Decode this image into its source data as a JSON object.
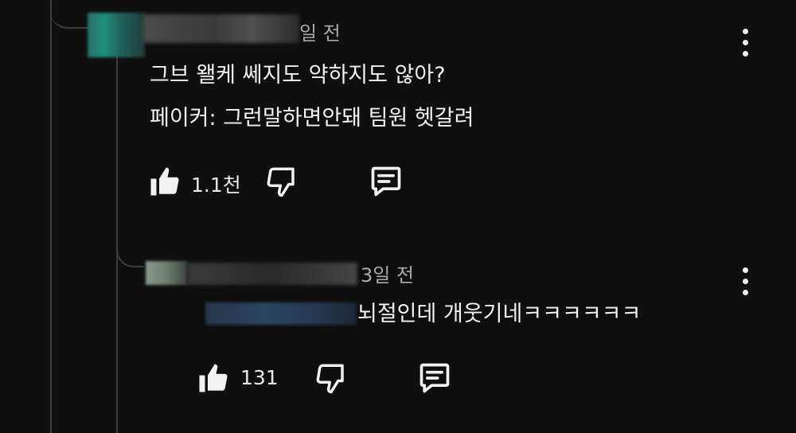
{
  "comments": [
    {
      "time": "일 전",
      "lines": [
        "그브 왤케 쎄지도 약하지도 않아?",
        "페이커: 그런말하면안돼 팀원 헷갈려"
      ],
      "like_count": "1.1천"
    },
    {
      "time": "3일 전",
      "text": "뇌절인데 개웃기네ㅋㅋㅋㅋㅋㅋ",
      "like_count": "131"
    }
  ],
  "icons": [
    "like-icon",
    "dislike-icon",
    "reply-icon",
    "more-vert-icon"
  ]
}
